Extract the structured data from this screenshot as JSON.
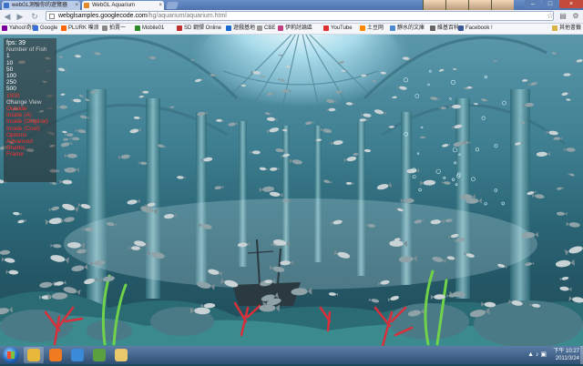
{
  "browser": {
    "tabs": [
      {
        "title": "webGL測驗你的遊覽器",
        "active": false
      },
      {
        "title": "WebGL Aquarium",
        "active": true
      }
    ],
    "address": {
      "host": "webglsamples.googlecode.com",
      "path": "/hg/aquarium/aquarium.html"
    },
    "bookmarks": [
      {
        "label": "Yahoo!奇摩",
        "color": "#7b0099"
      },
      {
        "label": "Google",
        "color": "#3b6fd9"
      },
      {
        "label": "PLURK 噗浪",
        "color": "#ff6600"
      },
      {
        "label": "拍賣一",
        "color": "#888888"
      },
      {
        "label": "Mobile01",
        "color": "#2a8a2a"
      },
      {
        "label": "SD 鋼彈 Online",
        "color": "#c03030"
      },
      {
        "label": "遊戲基地",
        "color": "#1a6ad0"
      },
      {
        "label": "CBE",
        "color": "#999999"
      },
      {
        "label": "伊莉討論區",
        "color": "#c04080"
      },
      {
        "label": "YouTube",
        "color": "#e03030"
      },
      {
        "label": "土豆网",
        "color": "#ff8800"
      },
      {
        "label": "靜水的文庫",
        "color": "#4a8ad0"
      },
      {
        "label": "維基百科",
        "color": "#666666"
      },
      {
        "label": "Facebook !",
        "color": "#3b5998"
      }
    ],
    "other_bookmarks": "其他書籤"
  },
  "hud": {
    "fps": "fps: 39",
    "number_of_fish_label": "Number of Fish",
    "fish_options": [
      "1",
      "10",
      "50",
      "100",
      "250",
      "500",
      "1000"
    ],
    "selected_fish": "1000",
    "change_view_label": "Change View",
    "view_options": [
      "Outside",
      "Inside (A)",
      "Inside (Original)",
      "Inside (Cool)"
    ],
    "extra_options": [
      "Options",
      "Advanced",
      "Sharks",
      "Frame"
    ]
  },
  "taskbar": {
    "time": "下午 10:27",
    "date": "2011/3/24",
    "apps": [
      {
        "name": "chrome",
        "color": "#e8b83a"
      },
      {
        "name": "media-player",
        "color": "#f07a20"
      },
      {
        "name": "itunes",
        "color": "#3a8ad8"
      },
      {
        "name": "game-app",
        "color": "#5aa040"
      },
      {
        "name": "folder",
        "color": "#e8c86a"
      }
    ]
  }
}
